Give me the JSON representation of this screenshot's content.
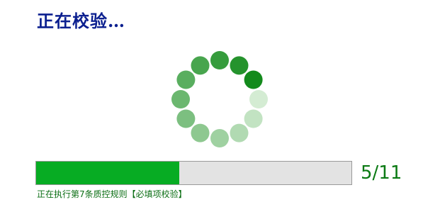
{
  "title": "正在校验…",
  "spinner": {
    "icon": "loading-spinner-icon",
    "dot_count": 12,
    "head_color": "#138a1c",
    "tail_color": "#d4ecd3"
  },
  "progress": {
    "current": 5,
    "total": 11,
    "fraction": 0.4545,
    "fill_color": "#07ac23",
    "track_color": "#e3e3e3",
    "label": "5/11"
  },
  "status": {
    "message": "正在执行第7条质控规则【必填项校验】"
  },
  "colors": {
    "title": "#0b1f8f",
    "count": "#0b7a14",
    "status": "#0b6e14"
  }
}
